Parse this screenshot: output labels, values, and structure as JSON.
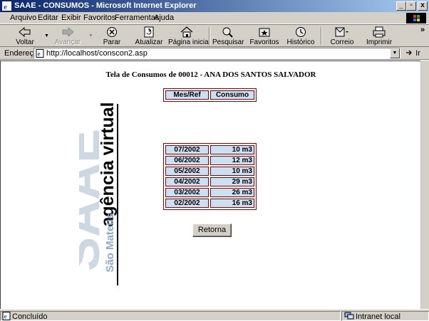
{
  "window": {
    "title": "SAAE - CONSUMOS - Microsoft Internet Explorer",
    "min_label": "_",
    "max_label": "▫",
    "close_label": "x"
  },
  "menu": [
    "Arquivo",
    "Editar",
    "Exibir",
    "Favoritos",
    "Ferramentas",
    "Ajuda"
  ],
  "toolbar": {
    "back": "Voltar",
    "forward": "Avançar",
    "stop": "Parar",
    "refresh": "Atualizar",
    "home": "Página inicial",
    "search": "Pesquisar",
    "favorites": "Favoritos",
    "history": "Histórico",
    "mail": "Correio",
    "print": "Imprimir",
    "more": "»"
  },
  "address": {
    "label": "Endereço",
    "url": "http://localhost/conscon2.asp",
    "go": "Ir"
  },
  "page": {
    "heading": "Tela de Consumos de 00012 - ANA DOS SANTOS SALVADOR",
    "logo_main": "agência virtual",
    "logo_brand": "SAAE",
    "logo_city": "São Mateus",
    "header": {
      "mes": "Mes/Ref",
      "consumo": "Consumo"
    },
    "rows": [
      {
        "mes": "07/2002",
        "consumo": "10 m3"
      },
      {
        "mes": "06/2002",
        "consumo": "12 m3"
      },
      {
        "mes": "05/2002",
        "consumo": "10 m3"
      },
      {
        "mes": "04/2002",
        "consumo": "29 m3"
      },
      {
        "mes": "03/2002",
        "consumo": "26 m3"
      },
      {
        "mes": "02/2002",
        "consumo": "16 m3"
      }
    ],
    "button": "Retorna"
  },
  "status": {
    "left": "Concluído",
    "zone": "Intranet local"
  }
}
